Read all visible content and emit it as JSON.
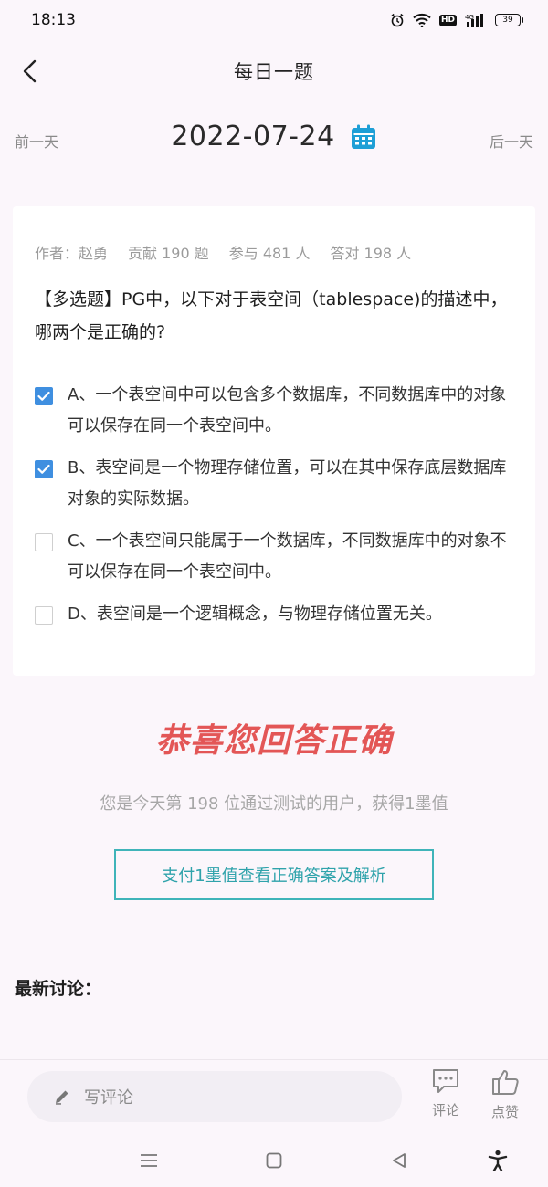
{
  "status_bar": {
    "time": "18:13",
    "hd": "HD",
    "signal_label": "4G",
    "battery": "39"
  },
  "header": {
    "title": "每日一题"
  },
  "date_nav": {
    "prev": "前一天",
    "date": "2022-07-24",
    "next": "后一天"
  },
  "question": {
    "author": "作者：赵勇",
    "contributed": "贡献 190 题",
    "participated": "参与 481 人",
    "correct": "答对 198 人",
    "text": "【多选题】PG中，以下对于表空间（tablespace)的描述中，哪两个是正确的?",
    "options": [
      {
        "label": "A、一个表空间中可以包含多个数据库，不同数据库中的对象可以保存在同一个表空间中。",
        "checked": true
      },
      {
        "label": "B、表空间是一个物理存储位置，可以在其中保存底层数据库对象的实际数据。",
        "checked": true
      },
      {
        "label": "C、一个表空间只能属于一个数据库，不同数据库中的对象不可以保存在同一个表空间中。",
        "checked": false
      },
      {
        "label": "D、表空间是一个逻辑概念，与物理存储位置无关。",
        "checked": false
      }
    ]
  },
  "result": {
    "congrats": "恭喜您回答正确",
    "description": "您是今天第 198 位通过测试的用户，获得1墨值",
    "pay_button": "支付1墨值查看正确答案及解析"
  },
  "discussion": {
    "title": "最新讨论："
  },
  "bottom_bar": {
    "comment_placeholder": "写评论",
    "comment_label": "评论",
    "like_label": "点赞"
  },
  "colors": {
    "accent_blue": "#3f8fe0",
    "teal": "#3fb4b9",
    "red": "#e35656",
    "calendar": "#1e9fd6"
  }
}
